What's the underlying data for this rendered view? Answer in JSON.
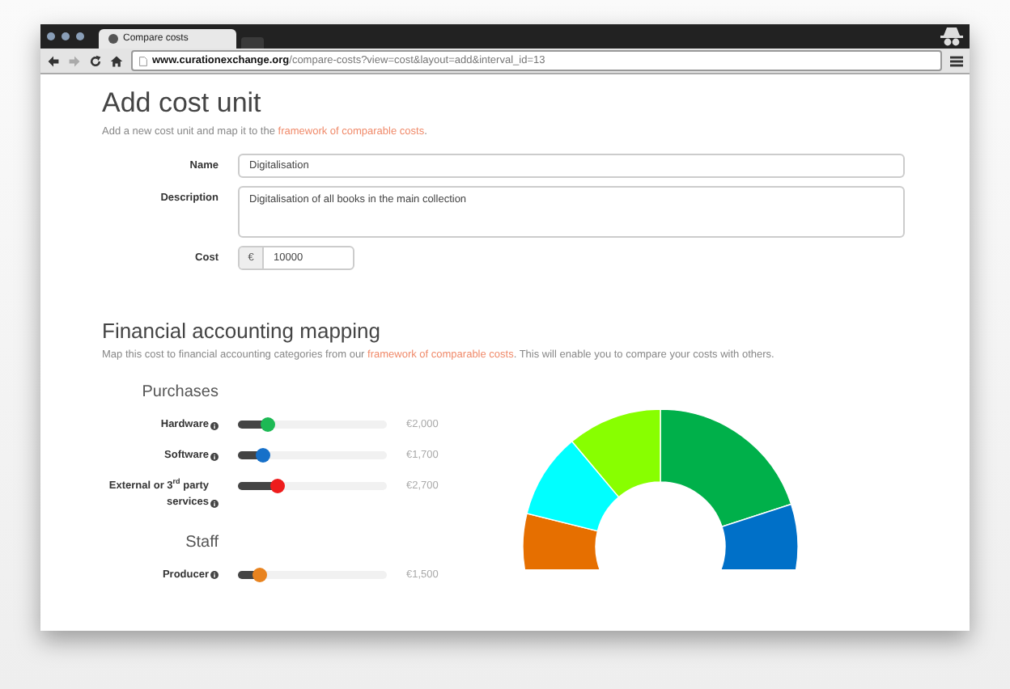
{
  "browser": {
    "tab_title": "Compare costs",
    "url": "**www.curationexchange.org**/compare-costs?view=cost&layout=add&interval_id=13"
  },
  "header": {
    "title": "Add cost unit",
    "intro": "Add a new cost unit and map it to the ",
    "intro_link": "framework of comparable costs",
    "intro_end": "."
  },
  "form": {
    "fields": [
      {
        "kind": "input",
        "label": "Name",
        "value": "Digitalisation"
      },
      {
        "kind": "textarea",
        "label": "Description",
        "value": "Digitalisation of all books in the main collection"
      },
      {
        "kind": "currency",
        "label": "Cost",
        "prefix": "€",
        "value": "10000"
      }
    ]
  },
  "mapping": {
    "title": "Financial accounting mapping",
    "intro": "Map this cost to financial accounting categories from our ",
    "intro_link": "framework of comparable costs",
    "intro_end": ". This will enable you to compare your costs with others.",
    "groups": [
      {
        "title": "Purchases",
        "sliders": [
          {
            "label": "Hardware",
            "level": 0.2,
            "value": "€2,000",
            "color": "#1db954"
          },
          {
            "label": "Software",
            "level": 0.17,
            "value": "€1,700",
            "color": "#1670c9"
          },
          {
            "label": "External or 3$^{rd}$ party services",
            "level": 0.27,
            "value": "€2,700",
            "color": "#ee1c1c"
          }
        ]
      },
      {
        "title": "Staff",
        "sliders": [
          {
            "label": "Producer",
            "level": 0.15,
            "value": "€1,500",
            "color": "#e8831f"
          }
        ]
      }
    ]
  }
}
